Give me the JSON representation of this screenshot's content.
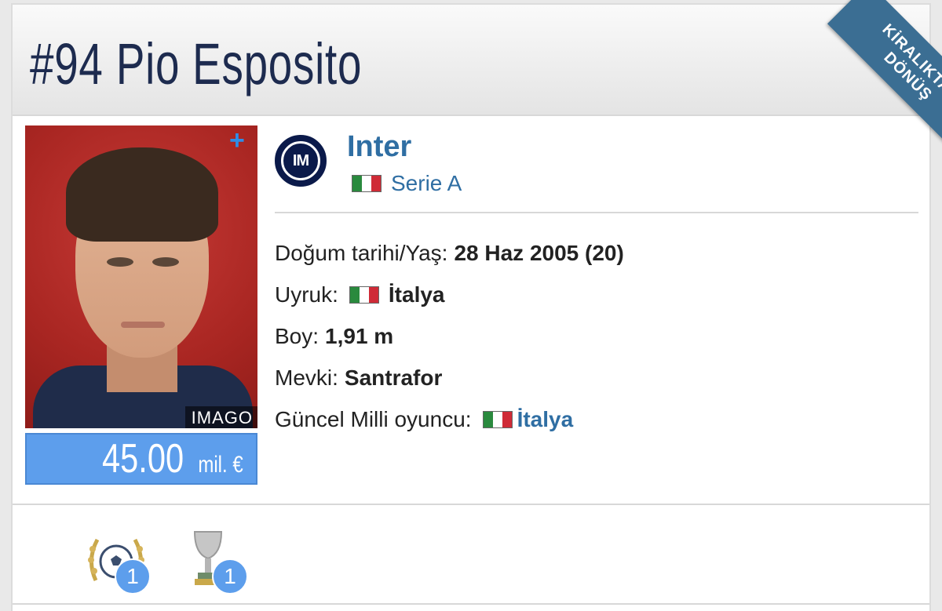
{
  "player": {
    "number": "#94",
    "name": "Pio Esposito",
    "photo_credit": "IMAGO",
    "market_value": "45.00",
    "market_value_unit": "mil. €"
  },
  "ribbon": {
    "line1": "KİRALIKTAN",
    "line2": "DÖNÜŞ"
  },
  "club": {
    "name": "Inter",
    "league": "Serie A"
  },
  "facts": {
    "birth_label": "Doğum tarihi/Yaş:",
    "birth_value": "28 Haz 2005 (20)",
    "nationality_label": "Uyruk:",
    "nationality_value": "İtalya",
    "height_label": "Boy:",
    "height_value": "1,91 m",
    "position_label": "Mevki:",
    "position_value": "Santrafor",
    "national_label": "Güncel Milli oyuncu:",
    "national_value": "İtalya"
  },
  "awards": [
    {
      "icon": "laurel-football-icon",
      "count": "1"
    },
    {
      "icon": "silver-cup-icon",
      "count": "1"
    }
  ],
  "colors": {
    "accent": "#5d9eec",
    "link": "#2f6ea3",
    "ribbon": "#3b6e93",
    "title": "#1d2b4f"
  },
  "icons": {
    "add": "plus-icon",
    "italy_flag": "italy-flag-icon",
    "club_logo": "inter-logo-icon"
  }
}
